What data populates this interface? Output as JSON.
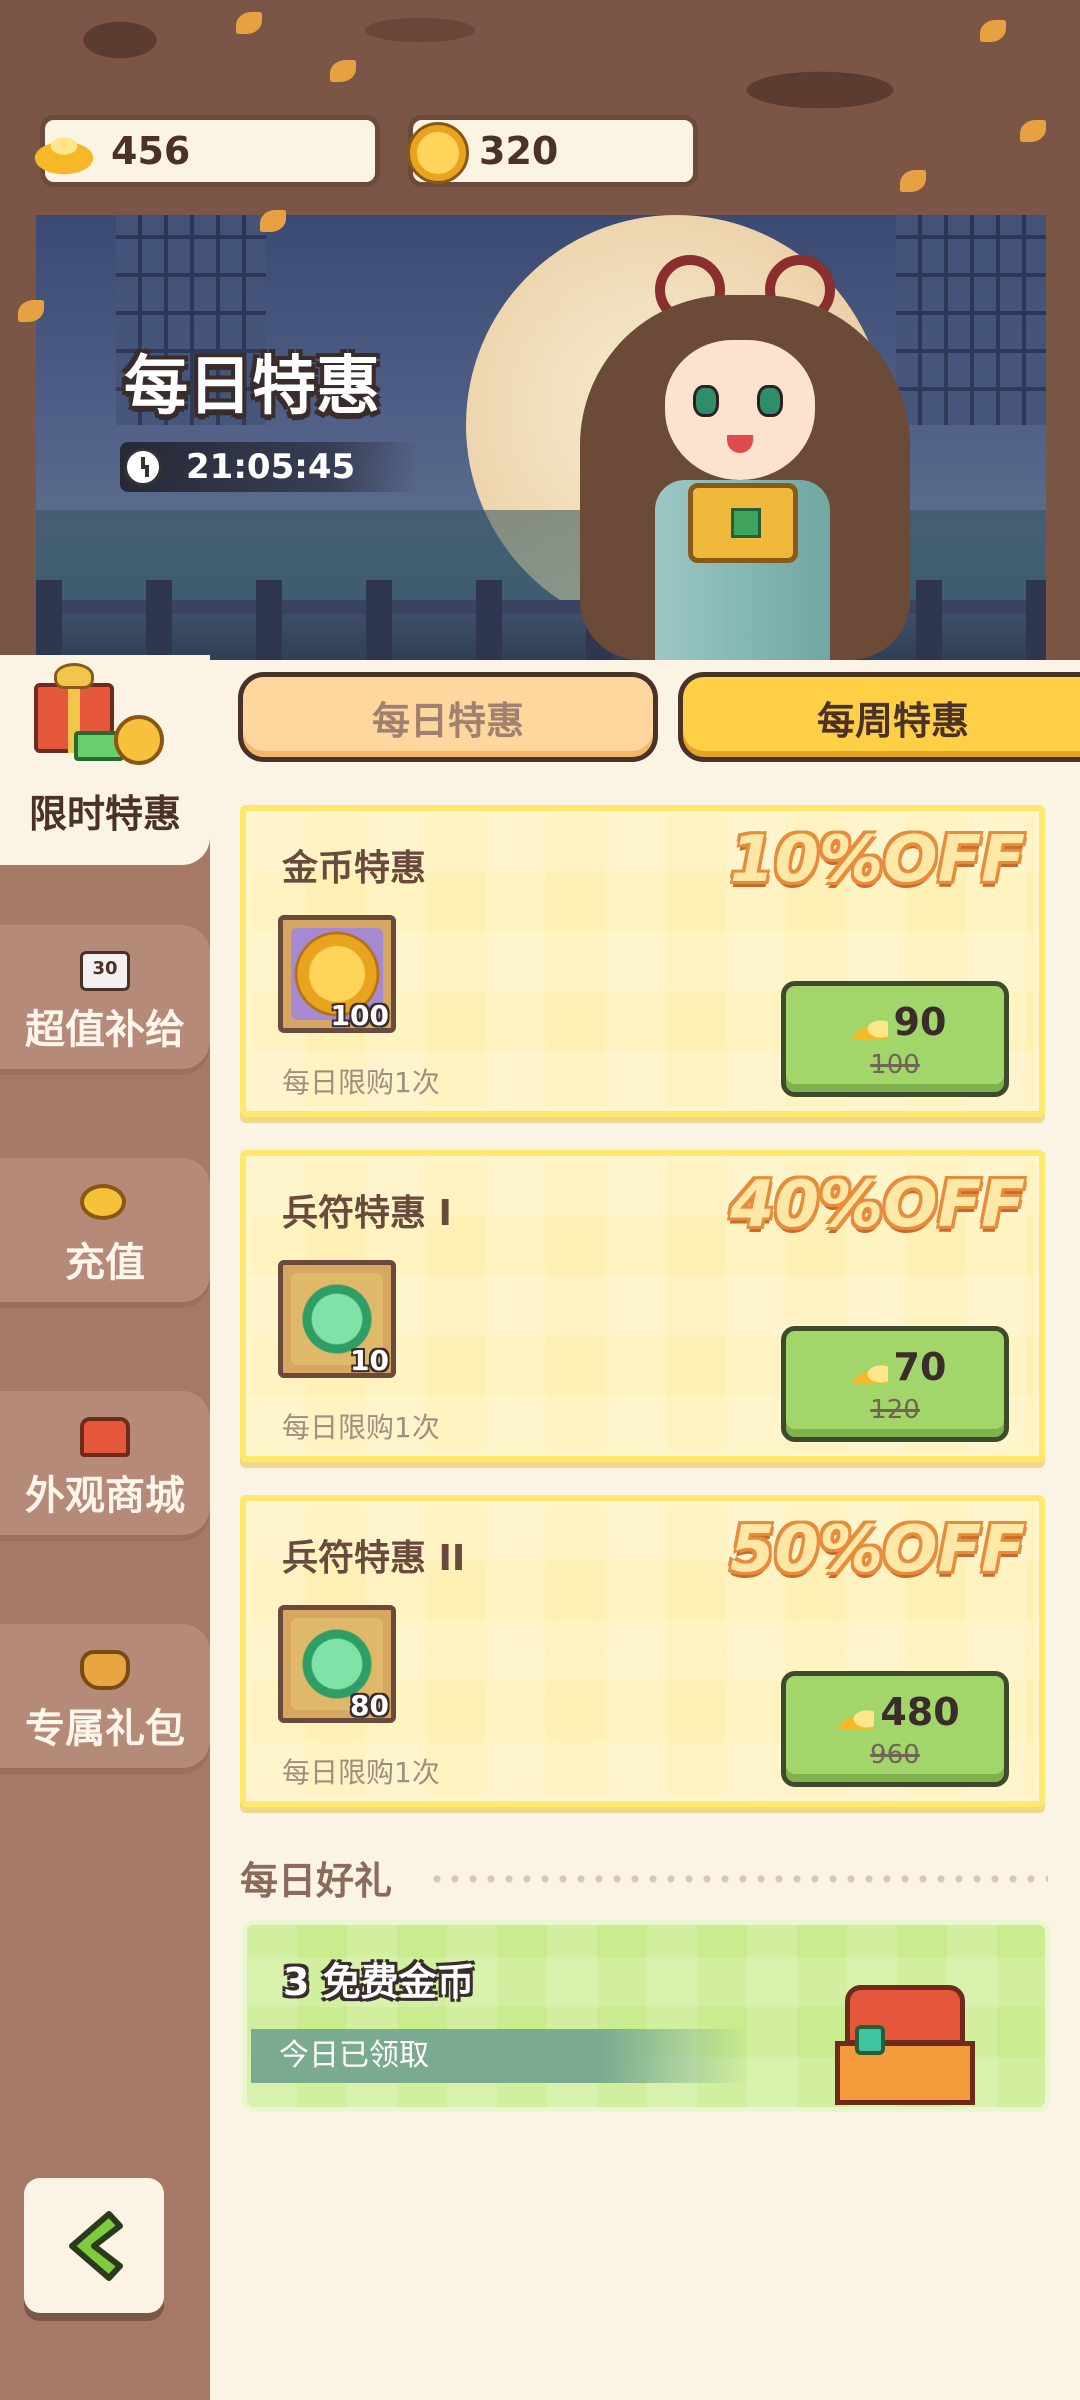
{
  "hero": {
    "title": "每日特惠",
    "timer": "21:05:45"
  },
  "currencies": [
    {
      "icon": "gold-ingot-icon",
      "value": "456"
    },
    {
      "icon": "gold-coin-icon",
      "value": "320"
    }
  ],
  "sidebar": {
    "active": {
      "label": "限时特惠",
      "icon": "gift-box-icon"
    },
    "items": [
      {
        "label": "超值补给",
        "icon": "supply-30-icon"
      },
      {
        "label": "充值",
        "icon": "gold-ingot-icon"
      },
      {
        "label": "外观商城",
        "icon": "shop-icon"
      },
      {
        "label": "专属礼包",
        "icon": "gift-bag-icon"
      }
    ],
    "back_icon": "back-arrow-icon"
  },
  "tabs": [
    {
      "label": "每日特惠",
      "selected": false
    },
    {
      "label": "每周特惠",
      "selected": true
    }
  ],
  "offers": [
    {
      "name": "金币特惠",
      "item_icon": "gold-coin-icon",
      "qty": "100",
      "limit": "每日限购1次",
      "discount": "10%OFF",
      "price": "90",
      "original_price": "100"
    },
    {
      "name": "兵符特惠 I",
      "item_icon": "jade-token-icon",
      "qty": "10",
      "limit": "每日限购1次",
      "discount": "40%OFF",
      "price": "70",
      "original_price": "120"
    },
    {
      "name": "兵符特惠 II",
      "item_icon": "jade-token-icon",
      "qty": "80",
      "limit": "每日限购1次",
      "discount": "50%OFF",
      "price": "480",
      "original_price": "960"
    }
  ],
  "daily_gift": {
    "section_title": "每日好礼",
    "title": "3 免费金币",
    "status": "今日已领取",
    "icon": "treasure-chest-icon"
  },
  "colors": {
    "accent_yellow": "#ffcf45",
    "buy_green": "#a3d66a",
    "sidebar_brown": "#a67866",
    "background": "#fbf3e4"
  }
}
